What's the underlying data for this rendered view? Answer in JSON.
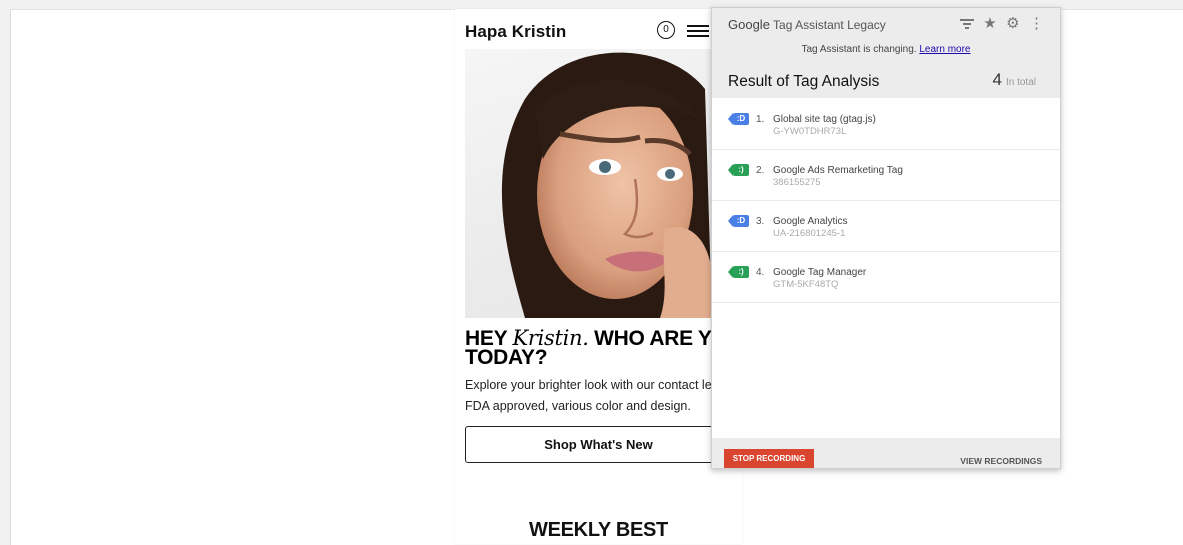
{
  "site": {
    "brand": "Hapa Kristin",
    "cart_count": "0",
    "headline_pre": "HEY ",
    "headline_script": "Kristin.",
    "headline_post": " WHO ARE YOU TODAY?",
    "description": "Explore your brighter look with our contact lens. FDA approved, various color and design.",
    "shop_button": "Shop What's New",
    "weekly_title": "WEEKLY BEST"
  },
  "tag_assistant": {
    "logo_google": "Google",
    "logo_product": "Tag Assistant Legacy",
    "icons": [
      "filter-icon",
      "star-icon",
      "gear-icon",
      "more-vert-icon"
    ],
    "notice": "Tag Assistant is changing.",
    "notice_link": "Learn more",
    "result_title": "Result of Tag Analysis",
    "count": "4",
    "count_label": "In total",
    "tags": [
      {
        "num": "1.",
        "name": "Global site tag (gtag.js)",
        "id": "G-YW0TDHR73L",
        "color": "blue",
        "glyph": ":D"
      },
      {
        "num": "2.",
        "name": "Google Ads Remarketing Tag",
        "id": "386155275",
        "color": "green",
        "glyph": ":)"
      },
      {
        "num": "3.",
        "name": "Google Analytics",
        "id": "UA-216801245-1",
        "color": "blue",
        "glyph": ":D"
      },
      {
        "num": "4.",
        "name": "Google Tag Manager",
        "id": "GTM-5KF48TQ",
        "color": "green",
        "glyph": ":)"
      }
    ],
    "stop_recording": "STOP RECORDING",
    "view_recordings": "VIEW RECORDINGS"
  },
  "colors": {
    "tag_blue": "#4a7fe6",
    "tag_green": "#28a157",
    "stop_red": "#d9452f"
  }
}
